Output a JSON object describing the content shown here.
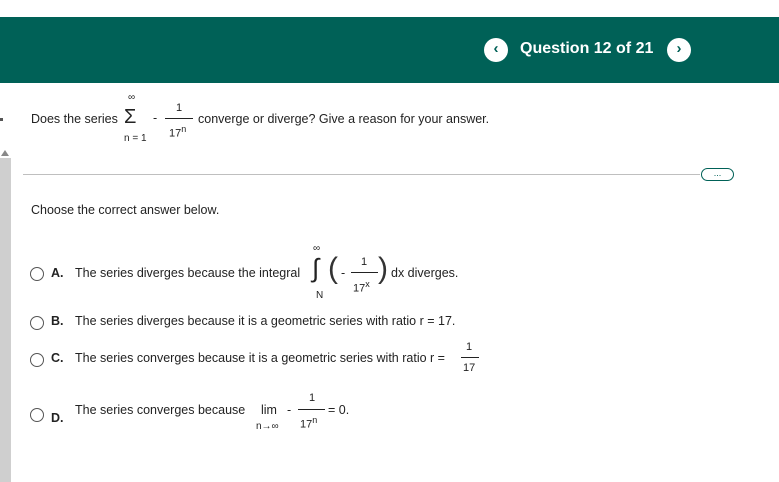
{
  "header": {
    "prev_icon": "‹",
    "question_label": "Question 12 of 21",
    "next_icon": "›",
    "bar_color": "#006157"
  },
  "question": {
    "prefix": "Does the series",
    "sigma": "Σ",
    "upper": "∞",
    "lower": "n = 1",
    "minus": "-",
    "numerator": "1",
    "denominator_base": "17",
    "denominator_exp": "n",
    "suffix": "converge or diverge? Give a reason for your answer."
  },
  "more_label": "...",
  "instruction": "Choose the correct answer below.",
  "options": {
    "a": {
      "letter": "A.",
      "text": "The series diverges because the integral",
      "int_upper": "∞",
      "int_lower": "N",
      "integral_sign": "∫",
      "minus": "-",
      "numerator": "1",
      "denominator_base": "17",
      "denominator_exp": "x",
      "suffix": "dx diverges."
    },
    "b": {
      "letter": "B.",
      "text": "The series diverges because it is a geometric series with ratio r = 17."
    },
    "c": {
      "letter": "C.",
      "text": "The series converges because it is a geometric series with ratio r =",
      "numerator": "1",
      "denominator": "17"
    },
    "d": {
      "letter": "D.",
      "text": "The series converges because",
      "lim": "lim",
      "lim_sub": "n→∞",
      "minus": "-",
      "numerator": "1",
      "denominator_base": "17",
      "denominator_exp": "n",
      "suffix": "= 0."
    }
  }
}
